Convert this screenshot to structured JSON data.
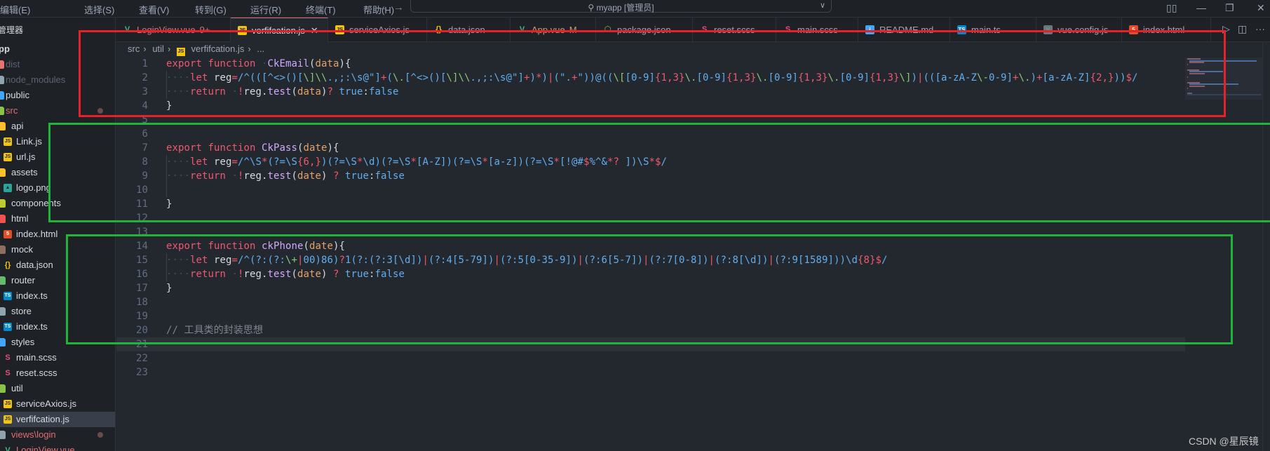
{
  "menu": [
    "编辑(E)",
    "选择(S)",
    "查看(V)",
    "转到(G)",
    "运行(R)",
    "终端(T)",
    "帮助(H)"
  ],
  "nav": {
    "back": "←",
    "forward": "→"
  },
  "command_center": {
    "icon": "search-icon",
    "text": "myapp [管理员]"
  },
  "window_controls": {
    "layout": "▯▯",
    "minimize": "—",
    "maximize": "❐",
    "close": "✕"
  },
  "sidebar": {
    "header": "管理器",
    "root": "pp",
    "items": [
      {
        "label": "dist",
        "icon": "folder-dist-icon",
        "level": 0,
        "dim": true
      },
      {
        "label": "node_modules",
        "icon": "folder-node-icon",
        "level": 0,
        "dim": true
      },
      {
        "label": "public",
        "icon": "folder-public-icon",
        "level": 0
      },
      {
        "label": "src",
        "icon": "folder-src-icon",
        "level": 0,
        "modified": true
      },
      {
        "label": "api",
        "icon": "folder-api-icon",
        "level": 1
      },
      {
        "label": "Link.js",
        "icon": "js-file-icon",
        "level": 2
      },
      {
        "label": "url.js",
        "icon": "js-file-icon",
        "level": 2
      },
      {
        "label": "assets",
        "icon": "folder-assets-icon",
        "level": 1
      },
      {
        "label": "logo.png",
        "icon": "image-file-icon",
        "level": 2
      },
      {
        "label": "components",
        "icon": "folder-components-icon",
        "level": 1
      },
      {
        "label": "html",
        "icon": "folder-html-icon",
        "level": 1
      },
      {
        "label": "index.html",
        "icon": "html-file-icon",
        "level": 2
      },
      {
        "label": "mock",
        "icon": "folder-mock-icon",
        "level": 1
      },
      {
        "label": "data.json",
        "icon": "json-file-icon",
        "level": 2
      },
      {
        "label": "router",
        "icon": "folder-router-icon",
        "level": 1
      },
      {
        "label": "index.ts",
        "icon": "ts-file-icon",
        "level": 2
      },
      {
        "label": "store",
        "icon": "folder-store-icon",
        "level": 1
      },
      {
        "label": "index.ts",
        "icon": "ts-file-icon",
        "level": 2
      },
      {
        "label": "styles",
        "icon": "folder-styles-icon",
        "level": 1
      },
      {
        "label": "main.scss",
        "icon": "sass-file-icon",
        "level": 2
      },
      {
        "label": "reset.scss",
        "icon": "sass-file-icon",
        "level": 2
      },
      {
        "label": "util",
        "icon": "folder-util-icon",
        "level": 1
      },
      {
        "label": "serviceAxios.js",
        "icon": "js-file-icon",
        "level": 2
      },
      {
        "label": "verfifcation.js",
        "icon": "js-file-icon",
        "level": 2,
        "selected": true
      },
      {
        "label": "views\\login",
        "icon": "folder-views-icon",
        "level": 1,
        "modified": true
      },
      {
        "label": "LoginView.vue",
        "icon": "vue-file-icon",
        "level": 2,
        "error": true
      }
    ]
  },
  "tabs": [
    {
      "label": "LoginView.vue",
      "badge": "9+",
      "icon": "vue-file-icon",
      "color": "#e06c75"
    },
    {
      "label": "verfifcation.js",
      "icon": "js-file-icon",
      "active": true,
      "close": "✕"
    },
    {
      "label": "serviceAxios.js",
      "icon": "js-file-icon"
    },
    {
      "label": "data.json",
      "icon": "json-file-icon"
    },
    {
      "label": "App.vue",
      "badge": "M",
      "icon": "vue-file-icon",
      "color": "#d19a66"
    },
    {
      "label": "package.json",
      "icon": "npm-package-icon"
    },
    {
      "label": "reset.scss",
      "icon": "sass-file-icon"
    },
    {
      "label": "main.scss",
      "icon": "sass-file-icon"
    },
    {
      "label": "README.md",
      "icon": "info-file-icon"
    },
    {
      "label": "main.ts",
      "icon": "ts-file-icon"
    },
    {
      "label": "vue.config.js",
      "icon": "vue-config-icon"
    },
    {
      "label": "index.html",
      "icon": "html-file-icon"
    }
  ],
  "tab_actions": {
    "run": "▷",
    "split": "◫",
    "more": "···"
  },
  "breadcrumb": [
    "src",
    "util",
    "verfifcation.js",
    "..."
  ],
  "code_lines": [
    "export function  CkEmail(data){",
    "    let reg=/^(([^<>()[\\]\\\\.,;:\\s@\"]+(\\.[^<>()[\\]\\\\.,;:\\s@\"]+)*)|(\".+\"))@((\\[[0-9]{1,3}\\.[0-9]{1,3}\\.[0-9]{1,3}\\.[0-9]{1,3}\\])|(([a-zA-Z\\-0-9]+\\.)+[a-zA-Z]{2,}))$/",
    "    return  !reg.test(data)? true:false",
    "}",
    "",
    "",
    "export function CkPass(date){",
    "    let reg=/^\\S*(?=\\S{6,})(?=\\S*\\d)(?=\\S*[A-Z])(?=\\S*[a-z])(?=\\S*[!@#$%^&*? ])\\S*$/",
    "    return  !reg.test(date) ? true:false",
    "",
    "}",
    "",
    "",
    "export function ckPhone(date){",
    "    let reg=/^(?:(?:\\+|00)86)?1(?:(?:3[\\d])|(?:4[5-79])|(?:5[0-35-9])|(?:6[5-7])|(?:7[0-8])|(?:8[\\d])|(?:9[1589]))\\d{8}$/",
    "    return  !reg.test(date) ? true:false",
    "}",
    "",
    "",
    "// 工具类的封装思想",
    "",
    "",
    ""
  ],
  "current_line": 21,
  "annotations": [
    {
      "color": "#e8202a"
    },
    {
      "color": "#22b33a"
    },
    {
      "color": "#22b33a"
    }
  ],
  "watermark": "CSDN @星辰镜"
}
